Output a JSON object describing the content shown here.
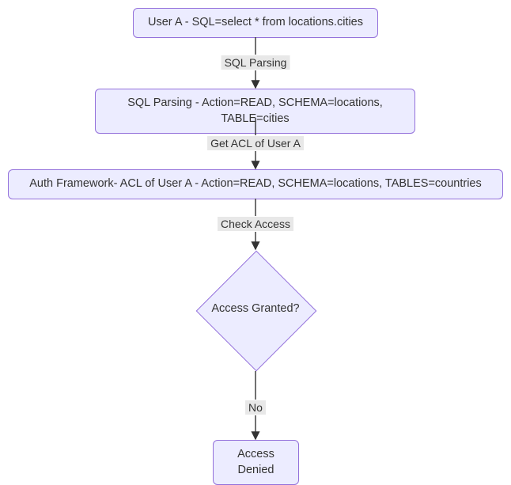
{
  "nodes": {
    "a": "User A - SQL=select * from locations.cities",
    "b": "SQL Parsing - Action=READ, SCHEMA=locations, TABLE=cities",
    "c": "Auth Framework- ACL of User A - Action=READ, SCHEMA=locations, TABLES=countries",
    "d": "Access Granted?",
    "e": "Access Denied"
  },
  "edges": {
    "ab": "SQL Parsing",
    "bc": "Get ACL of User A",
    "cd": "Check Access",
    "de": "No"
  }
}
